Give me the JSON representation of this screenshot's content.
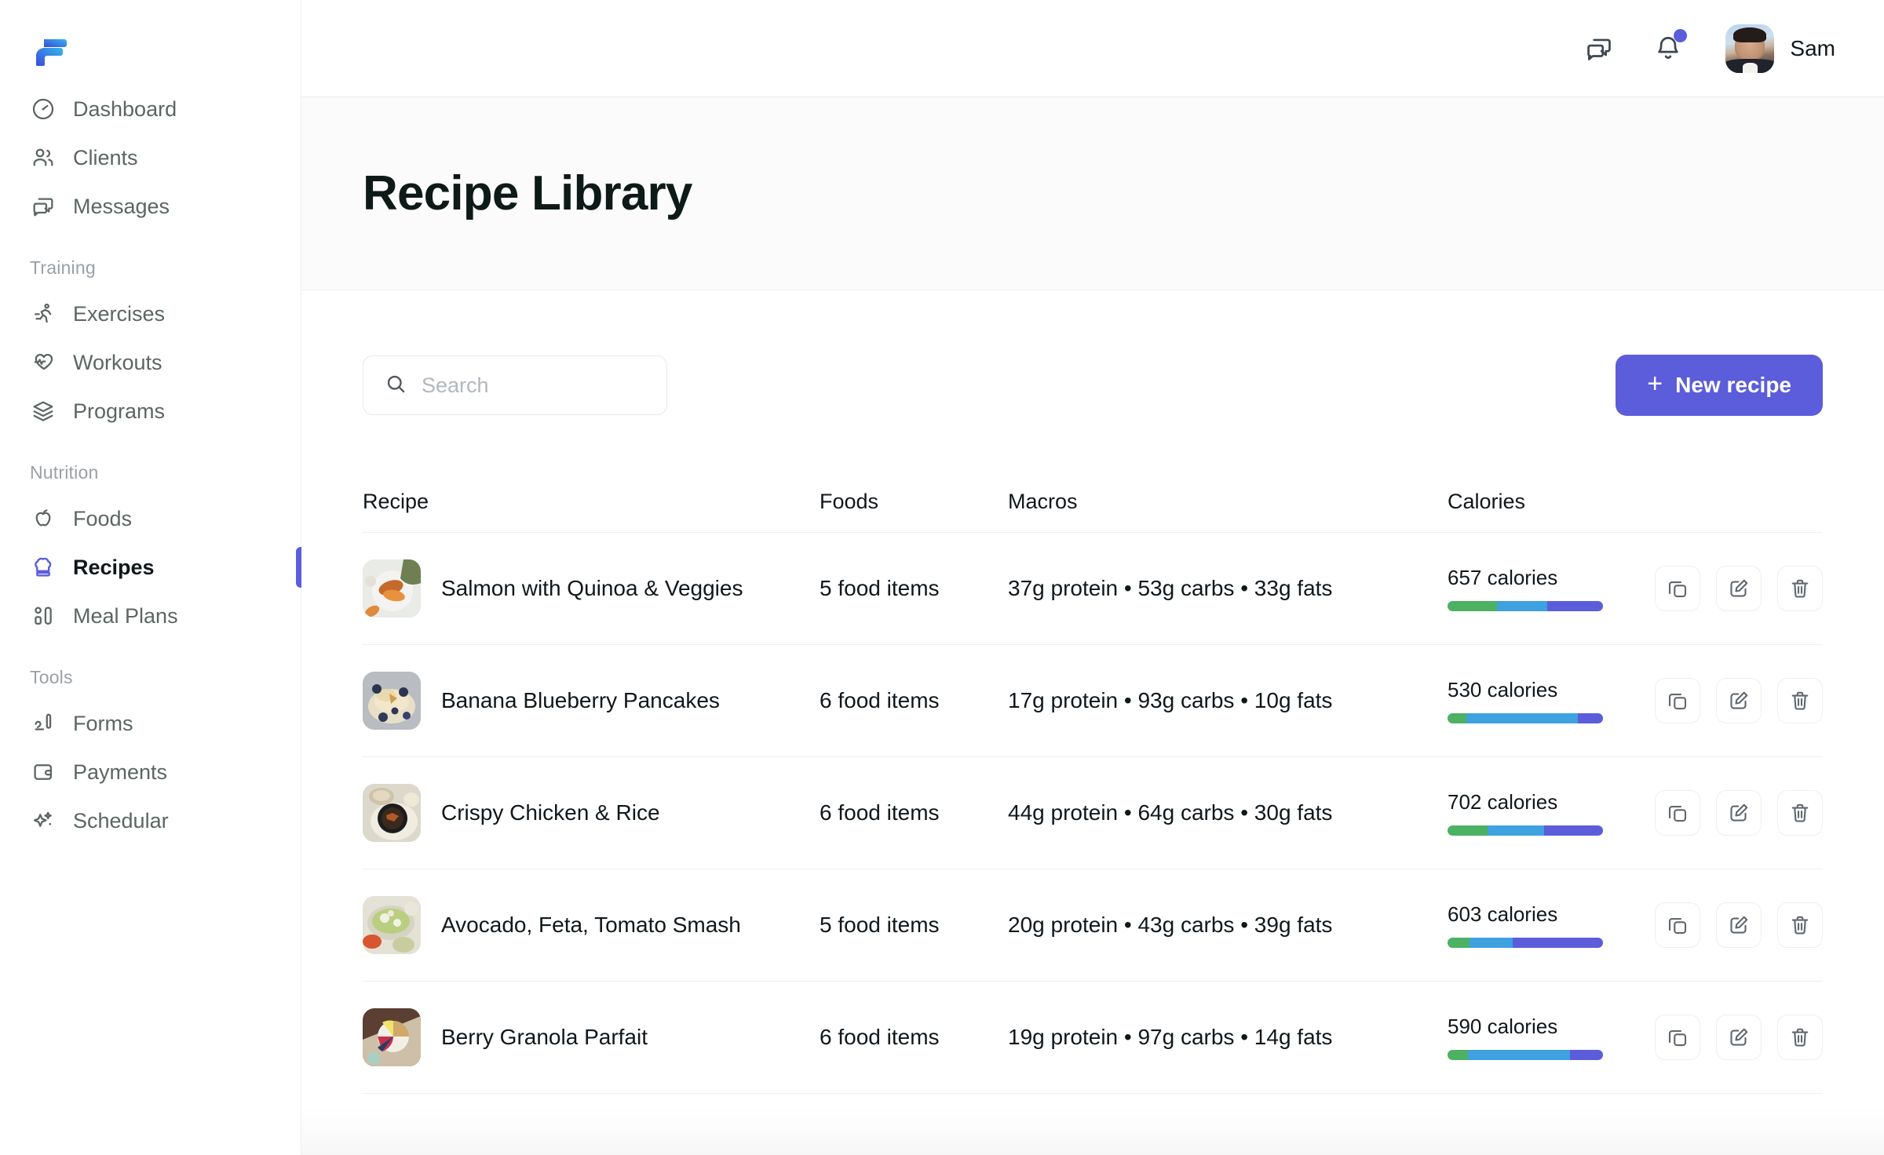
{
  "brand": {
    "logo_icon": "f-logo-icon",
    "accent_color": "#5b5ddb"
  },
  "sidebar": {
    "groups": [
      {
        "label": "",
        "items": [
          {
            "label": "Dashboard",
            "icon": "gauge-icon",
            "active": false
          },
          {
            "label": "Clients",
            "icon": "users-icon",
            "active": false
          },
          {
            "label": "Messages",
            "icon": "chat-icon",
            "active": false
          }
        ]
      },
      {
        "label": "Training",
        "items": [
          {
            "label": "Exercises",
            "icon": "running-person-icon",
            "active": false
          },
          {
            "label": "Workouts",
            "icon": "heart-pulse-icon",
            "active": false
          },
          {
            "label": "Programs",
            "icon": "layers-icon",
            "active": false
          }
        ]
      },
      {
        "label": "Nutrition",
        "items": [
          {
            "label": "Foods",
            "icon": "apple-icon",
            "active": false
          },
          {
            "label": "Recipes",
            "icon": "chef-hat-icon",
            "active": true
          },
          {
            "label": "Meal Plans",
            "icon": "meal-plan-grid-icon",
            "active": false
          }
        ]
      },
      {
        "label": "Tools",
        "items": [
          {
            "label": "Forms",
            "icon": "form-pen-icon",
            "active": false
          },
          {
            "label": "Payments",
            "icon": "wallet-icon",
            "active": false
          },
          {
            "label": "Schedular",
            "icon": "sparkle-icon",
            "active": false
          }
        ]
      }
    ]
  },
  "topbar": {
    "messages_icon": "chat-icon",
    "notifications_icon": "bell-icon",
    "has_unread_notification": true,
    "user_name": "Sam",
    "avatar_icon": "user-avatar"
  },
  "header": {
    "title": "Recipe Library"
  },
  "toolbar": {
    "search_placeholder": "Search",
    "search_value": "",
    "search_icon": "search-icon",
    "new_recipe_label": "New recipe",
    "new_recipe_plus": "+"
  },
  "table": {
    "columns": [
      "Recipe",
      "Foods",
      "Macros",
      "Calories"
    ],
    "actions": {
      "duplicate_icon": "copy-icon",
      "edit_icon": "edit-pencil-icon",
      "delete_icon": "trash-icon"
    },
    "rows": [
      {
        "name": "Salmon with Quinoa & Veggies",
        "foods": "5 food items",
        "macros": "37g protein • 53g carbs • 33g fats",
        "protein_g": 37,
        "carbs_g": 53,
        "fats_g": 33,
        "calories": "657 calories",
        "bar": {
          "protein_pct": 32,
          "carbs_pct": 32,
          "fats_pct": 36
        },
        "thumb": "salmon-quinoa-veggies-photo"
      },
      {
        "name": "Banana Blueberry Pancakes",
        "foods": "6 food items",
        "macros": "17g protein • 93g carbs • 10g fats",
        "protein_g": 17,
        "carbs_g": 93,
        "fats_g": 10,
        "calories": "530 calories",
        "bar": {
          "protein_pct": 12,
          "carbs_pct": 72,
          "fats_pct": 16
        },
        "thumb": "banana-blueberry-pancakes-photo"
      },
      {
        "name": "Crispy Chicken & Rice",
        "foods": "6 food items",
        "macros": "44g protein • 64g carbs • 30g fats",
        "protein_g": 44,
        "carbs_g": 64,
        "fats_g": 30,
        "calories": "702 calories",
        "bar": {
          "protein_pct": 26,
          "carbs_pct": 36,
          "fats_pct": 38
        },
        "thumb": "crispy-chicken-rice-photo"
      },
      {
        "name": "Avocado, Feta, Tomato Smash",
        "foods": "5 food items",
        "macros": "20g protein • 43g carbs • 39g fats",
        "protein_g": 20,
        "carbs_g": 43,
        "fats_g": 39,
        "calories": "603 calories",
        "bar": {
          "protein_pct": 14,
          "carbs_pct": 28,
          "fats_pct": 58
        },
        "thumb": "avocado-feta-tomato-smash-photo"
      },
      {
        "name": "Berry Granola Parfait",
        "foods": "6 food items",
        "macros": "19g protein • 97g carbs • 14g fats",
        "protein_g": 19,
        "carbs_g": 97,
        "fats_g": 14,
        "calories": "590 calories",
        "bar": {
          "protein_pct": 13,
          "carbs_pct": 66,
          "fats_pct": 21
        },
        "thumb": "berry-granola-parfait-photo"
      }
    ]
  },
  "macro_colors": {
    "protein": "#4cb163",
    "carbs": "#3fa1e0",
    "fats": "#5b5ddb"
  }
}
